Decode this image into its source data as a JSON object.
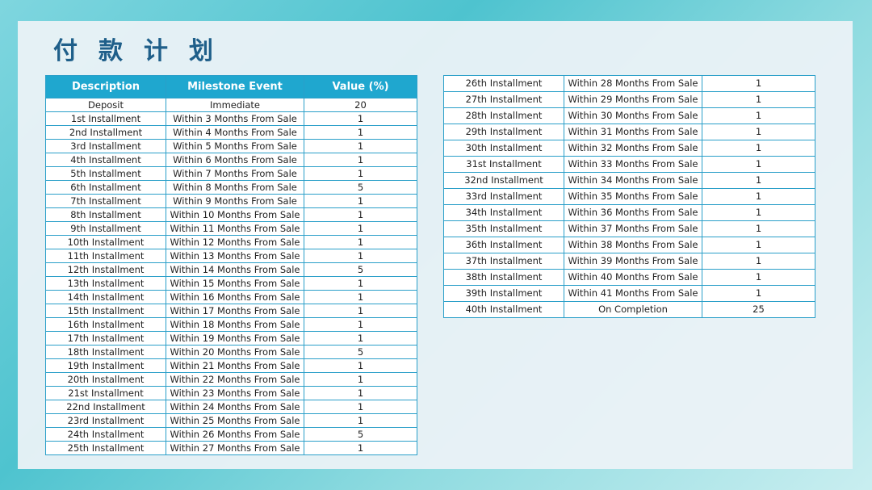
{
  "title": "付款计划",
  "colors": {
    "header_bg": "#1fa7cf",
    "border": "#2a9fc9",
    "title": "#1f5f8a"
  },
  "table": {
    "headers": [
      "Description",
      "Milestone Event",
      "Value (%)"
    ],
    "left_rows": [
      [
        "Deposit",
        "Immediate",
        "20"
      ],
      [
        "1st Installment",
        "Within 3 Months From Sale",
        "1"
      ],
      [
        "2nd Installment",
        "Within 4 Months From Sale",
        "1"
      ],
      [
        "3rd Installment",
        "Within 5 Months From Sale",
        "1"
      ],
      [
        "4th Installment",
        "Within 6 Months From Sale",
        "1"
      ],
      [
        "5th Installment",
        "Within 7 Months From Sale",
        "1"
      ],
      [
        "6th Installment",
        "Within 8 Months From Sale",
        "5"
      ],
      [
        "7th Installment",
        "Within 9 Months From Sale",
        "1"
      ],
      [
        "8th Installment",
        "Within 10 Months From Sale",
        "1"
      ],
      [
        "9th Installment",
        "Within 11 Months From Sale",
        "1"
      ],
      [
        "10th Installment",
        "Within 12 Months From Sale",
        "1"
      ],
      [
        "11th Installment",
        "Within 13 Months From Sale",
        "1"
      ],
      [
        "12th Installment",
        "Within 14 Months From Sale",
        "5"
      ],
      [
        "13th Installment",
        "Within 15 Months From Sale",
        "1"
      ],
      [
        "14th Installment",
        "Within 16 Months From Sale",
        "1"
      ],
      [
        "15th Installment",
        "Within 17 Months From Sale",
        "1"
      ],
      [
        "16th Installment",
        "Within 18 Months From Sale",
        "1"
      ],
      [
        "17th Installment",
        "Within 19 Months From Sale",
        "1"
      ],
      [
        "18th Installment",
        "Within 20 Months From Sale",
        "5"
      ],
      [
        "19th Installment",
        "Within 21 Months From Sale",
        "1"
      ],
      [
        "20th Installment",
        "Within 22 Months From Sale",
        "1"
      ],
      [
        "21st Installment",
        "Within 23 Months From Sale",
        "1"
      ],
      [
        "22nd Installment",
        "Within 24 Months From Sale",
        "1"
      ],
      [
        "23rd Installment",
        "Within 25 Months From Sale",
        "1"
      ],
      [
        "24th Installment",
        "Within 26 Months From Sale",
        "5"
      ],
      [
        "25th Installment",
        "Within 27 Months From Sale",
        "1"
      ]
    ],
    "right_rows": [
      [
        "26th Installment",
        "Within 28 Months From Sale",
        "1"
      ],
      [
        "27th Installment",
        "Within 29 Months From Sale",
        "1"
      ],
      [
        "28th Installment",
        "Within 30 Months From Sale",
        "1"
      ],
      [
        "29th Installment",
        "Within 31 Months From Sale",
        "1"
      ],
      [
        "30th Installment",
        "Within 32 Months From Sale",
        "1"
      ],
      [
        "31st Installment",
        "Within 33 Months From Sale",
        "1"
      ],
      [
        "32nd Installment",
        "Within 34 Months From Sale",
        "1"
      ],
      [
        "33rd Installment",
        "Within 35 Months From Sale",
        "1"
      ],
      [
        "34th Installment",
        "Within 36 Months From Sale",
        "1"
      ],
      [
        "35th Installment",
        "Within 37 Months From Sale",
        "1"
      ],
      [
        "36th Installment",
        "Within 38 Months From Sale",
        "1"
      ],
      [
        "37th Installment",
        "Within 39 Months From Sale",
        "1"
      ],
      [
        "38th Installment",
        "Within 40 Months From Sale",
        "1"
      ],
      [
        "39th Installment",
        "Within 41 Months From Sale",
        "1"
      ],
      [
        "40th Installment",
        "On Completion",
        "25"
      ]
    ]
  }
}
